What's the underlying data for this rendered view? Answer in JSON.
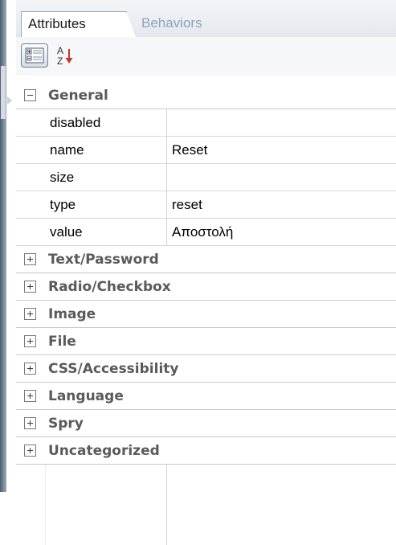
{
  "tabs": [
    {
      "label": "Attributes",
      "active": true
    },
    {
      "label": "Behaviors",
      "active": false
    }
  ],
  "toolbar": {
    "category_view_icon": "category-list-icon",
    "sort_icon": "sort-az-icon",
    "sort_glyph_top": "A",
    "sort_glyph_bottom": "Z"
  },
  "groups": [
    {
      "label": "General",
      "expanded": true,
      "properties": [
        {
          "name": "disabled",
          "value": ""
        },
        {
          "name": "name",
          "value": "Reset"
        },
        {
          "name": "size",
          "value": ""
        },
        {
          "name": "type",
          "value": "reset"
        },
        {
          "name": "value",
          "value": "Αποστολή"
        }
      ]
    },
    {
      "label": "Text/Password",
      "expanded": false
    },
    {
      "label": "Radio/Checkbox",
      "expanded": false
    },
    {
      "label": "Image",
      "expanded": false
    },
    {
      "label": "File",
      "expanded": false
    },
    {
      "label": "CSS/Accessibility",
      "expanded": false
    },
    {
      "label": "Language",
      "expanded": false
    },
    {
      "label": "Spry",
      "expanded": false
    },
    {
      "label": "Uncategorized",
      "expanded": false
    }
  ],
  "colors": {
    "group_text": "#5a5a5a",
    "inactive_tab_text": "#8ea2b8",
    "grid_line": "#c9c9c9"
  }
}
